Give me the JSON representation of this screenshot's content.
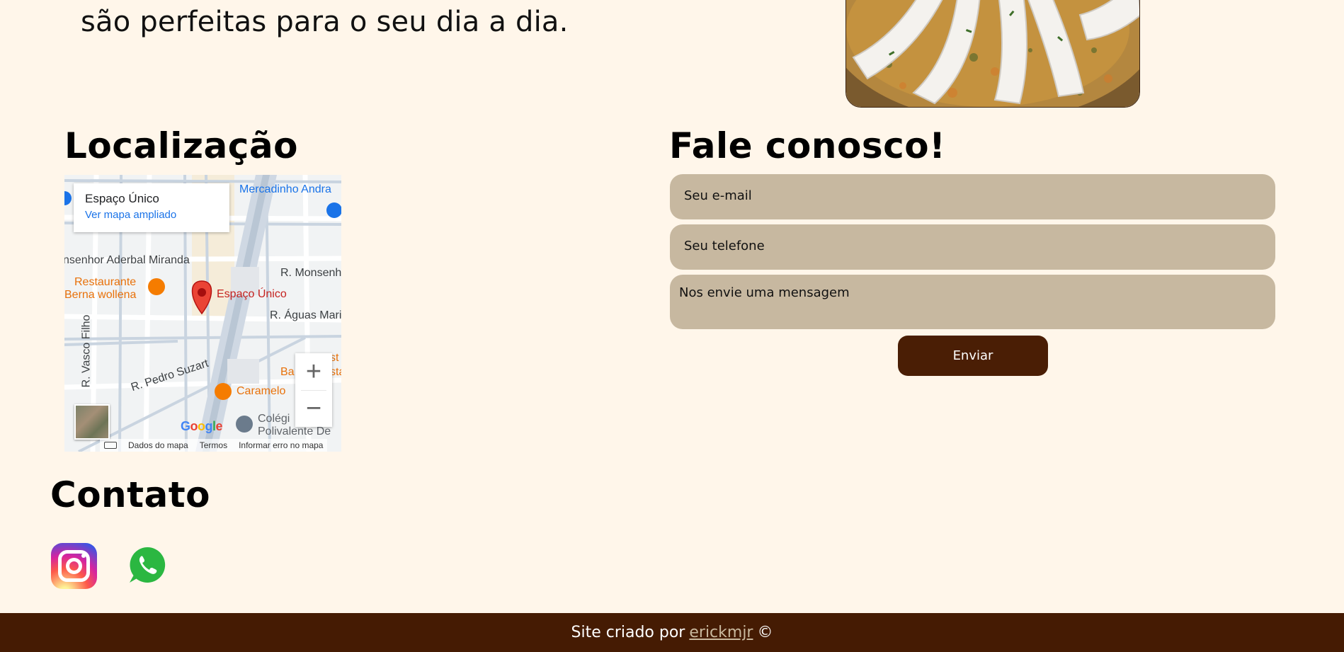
{
  "intro": {
    "line_partial": "são perfeitas para o seu dia a dia."
  },
  "location": {
    "title": "Localização",
    "map": {
      "place_name": "Espaço Único",
      "enlarge_link": "Ver mapa ampliado",
      "marker_label": "Espaço Único",
      "streets": [
        "Mercadinho Andra",
        "nsenhor Aderbal Miranda",
        "R. Monsenh",
        "R. Águas Mari",
        "R. Pedro Suzart",
        "R. Vasco Filho"
      ],
      "pois": [
        "Restaurante",
        "Berna wollena",
        "Caramelo",
        "Colégi",
        "Polivalente De",
        "Ba",
        "st",
        "sta"
      ],
      "zoom_in": "+",
      "zoom_out": "−",
      "logo": "Google",
      "footer": [
        "Dados do mapa",
        "Termos",
        "Informar erro no mapa"
      ]
    }
  },
  "form": {
    "title": "Fale conosco!",
    "email_placeholder": "Seu e-mail",
    "phone_placeholder": "Seu telefone",
    "message_placeholder": "Nos envie uma mensagem",
    "submit_label": "Enviar"
  },
  "contact": {
    "title": "Contato",
    "icons": [
      "instagram-icon",
      "whatsapp-icon"
    ]
  },
  "footer": {
    "prefix": "Site criado por",
    "author": "erickmjr",
    "suffix": "©"
  },
  "colors": {
    "background": "#fff6ea",
    "field": "#c7b8a0",
    "accent_dark": "#4a1e05",
    "footer": "#451b03"
  }
}
